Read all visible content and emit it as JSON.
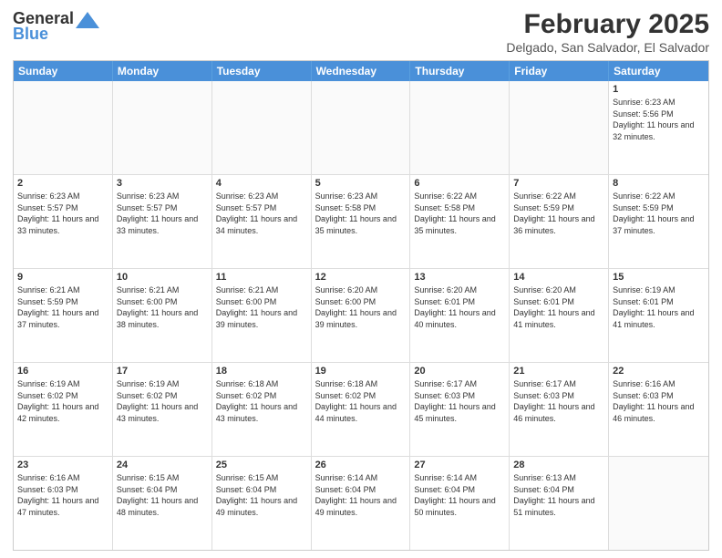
{
  "header": {
    "logo_general": "General",
    "logo_blue": "Blue",
    "title": "February 2025",
    "subtitle": "Delgado, San Salvador, El Salvador"
  },
  "days": [
    "Sunday",
    "Monday",
    "Tuesday",
    "Wednesday",
    "Thursday",
    "Friday",
    "Saturday"
  ],
  "weeks": [
    [
      {
        "day": "",
        "info": ""
      },
      {
        "day": "",
        "info": ""
      },
      {
        "day": "",
        "info": ""
      },
      {
        "day": "",
        "info": ""
      },
      {
        "day": "",
        "info": ""
      },
      {
        "day": "",
        "info": ""
      },
      {
        "day": "1",
        "info": "Sunrise: 6:23 AM\nSunset: 5:56 PM\nDaylight: 11 hours and 32 minutes."
      }
    ],
    [
      {
        "day": "2",
        "info": "Sunrise: 6:23 AM\nSunset: 5:57 PM\nDaylight: 11 hours and 33 minutes."
      },
      {
        "day": "3",
        "info": "Sunrise: 6:23 AM\nSunset: 5:57 PM\nDaylight: 11 hours and 33 minutes."
      },
      {
        "day": "4",
        "info": "Sunrise: 6:23 AM\nSunset: 5:57 PM\nDaylight: 11 hours and 34 minutes."
      },
      {
        "day": "5",
        "info": "Sunrise: 6:23 AM\nSunset: 5:58 PM\nDaylight: 11 hours and 35 minutes."
      },
      {
        "day": "6",
        "info": "Sunrise: 6:22 AM\nSunset: 5:58 PM\nDaylight: 11 hours and 35 minutes."
      },
      {
        "day": "7",
        "info": "Sunrise: 6:22 AM\nSunset: 5:59 PM\nDaylight: 11 hours and 36 minutes."
      },
      {
        "day": "8",
        "info": "Sunrise: 6:22 AM\nSunset: 5:59 PM\nDaylight: 11 hours and 37 minutes."
      }
    ],
    [
      {
        "day": "9",
        "info": "Sunrise: 6:21 AM\nSunset: 5:59 PM\nDaylight: 11 hours and 37 minutes."
      },
      {
        "day": "10",
        "info": "Sunrise: 6:21 AM\nSunset: 6:00 PM\nDaylight: 11 hours and 38 minutes."
      },
      {
        "day": "11",
        "info": "Sunrise: 6:21 AM\nSunset: 6:00 PM\nDaylight: 11 hours and 39 minutes."
      },
      {
        "day": "12",
        "info": "Sunrise: 6:20 AM\nSunset: 6:00 PM\nDaylight: 11 hours and 39 minutes."
      },
      {
        "day": "13",
        "info": "Sunrise: 6:20 AM\nSunset: 6:01 PM\nDaylight: 11 hours and 40 minutes."
      },
      {
        "day": "14",
        "info": "Sunrise: 6:20 AM\nSunset: 6:01 PM\nDaylight: 11 hours and 41 minutes."
      },
      {
        "day": "15",
        "info": "Sunrise: 6:19 AM\nSunset: 6:01 PM\nDaylight: 11 hours and 41 minutes."
      }
    ],
    [
      {
        "day": "16",
        "info": "Sunrise: 6:19 AM\nSunset: 6:02 PM\nDaylight: 11 hours and 42 minutes."
      },
      {
        "day": "17",
        "info": "Sunrise: 6:19 AM\nSunset: 6:02 PM\nDaylight: 11 hours and 43 minutes."
      },
      {
        "day": "18",
        "info": "Sunrise: 6:18 AM\nSunset: 6:02 PM\nDaylight: 11 hours and 43 minutes."
      },
      {
        "day": "19",
        "info": "Sunrise: 6:18 AM\nSunset: 6:02 PM\nDaylight: 11 hours and 44 minutes."
      },
      {
        "day": "20",
        "info": "Sunrise: 6:17 AM\nSunset: 6:03 PM\nDaylight: 11 hours and 45 minutes."
      },
      {
        "day": "21",
        "info": "Sunrise: 6:17 AM\nSunset: 6:03 PM\nDaylight: 11 hours and 46 minutes."
      },
      {
        "day": "22",
        "info": "Sunrise: 6:16 AM\nSunset: 6:03 PM\nDaylight: 11 hours and 46 minutes."
      }
    ],
    [
      {
        "day": "23",
        "info": "Sunrise: 6:16 AM\nSunset: 6:03 PM\nDaylight: 11 hours and 47 minutes."
      },
      {
        "day": "24",
        "info": "Sunrise: 6:15 AM\nSunset: 6:04 PM\nDaylight: 11 hours and 48 minutes."
      },
      {
        "day": "25",
        "info": "Sunrise: 6:15 AM\nSunset: 6:04 PM\nDaylight: 11 hours and 49 minutes."
      },
      {
        "day": "26",
        "info": "Sunrise: 6:14 AM\nSunset: 6:04 PM\nDaylight: 11 hours and 49 minutes."
      },
      {
        "day": "27",
        "info": "Sunrise: 6:14 AM\nSunset: 6:04 PM\nDaylight: 11 hours and 50 minutes."
      },
      {
        "day": "28",
        "info": "Sunrise: 6:13 AM\nSunset: 6:04 PM\nDaylight: 11 hours and 51 minutes."
      },
      {
        "day": "",
        "info": ""
      }
    ]
  ]
}
